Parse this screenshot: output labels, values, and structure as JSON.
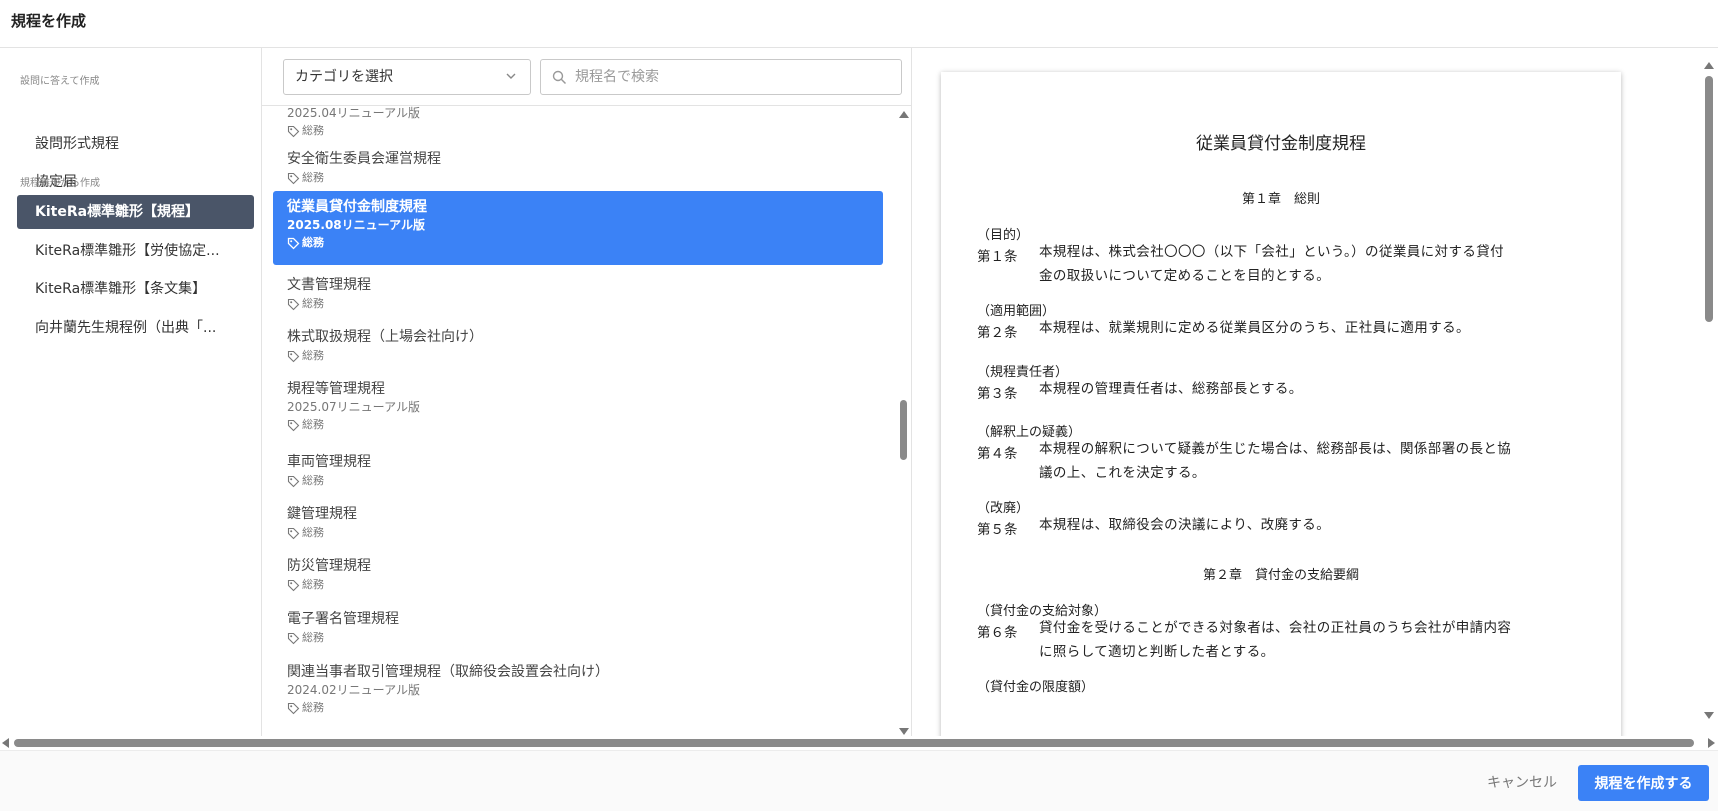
{
  "header": {
    "title": "規程を作成"
  },
  "sidebar": {
    "sections": [
      "設問に答えて作成",
      "規程雛形から作成"
    ],
    "items": [
      {
        "label": "設問形式規程"
      },
      {
        "label": "協定届"
      },
      {
        "label": "KiteRa標準雛形【規程】"
      },
      {
        "label": "KiteRa標準雛形【労使協定..."
      },
      {
        "label": "KiteRa標準雛形【条文集】"
      },
      {
        "label": "向井蘭先生規程例（出典「..."
      }
    ]
  },
  "filters": {
    "category_label": "カテゴリを選択",
    "search_placeholder": "規程名で検索"
  },
  "list": {
    "items": [
      {
        "title": "",
        "sub": "2025.04リニューアル版",
        "tag": "総務"
      },
      {
        "title": "安全衛生委員会運営規程",
        "sub": "",
        "tag": "総務"
      },
      {
        "title": "従業員貸付金制度規程",
        "sub": "2025.08リニューアル版",
        "tag": "総務"
      },
      {
        "title": "文書管理規程",
        "sub": "",
        "tag": "総務"
      },
      {
        "title": "株式取扱規程（上場会社向け）",
        "sub": "",
        "tag": "総務"
      },
      {
        "title": "規程等管理規程",
        "sub": "2025.07リニューアル版",
        "tag": "総務"
      },
      {
        "title": "車両管理規程",
        "sub": "",
        "tag": "総務"
      },
      {
        "title": "鍵管理規程",
        "sub": "",
        "tag": "総務"
      },
      {
        "title": "防災管理規程",
        "sub": "",
        "tag": "総務"
      },
      {
        "title": "電子署名管理規程",
        "sub": "",
        "tag": "総務"
      },
      {
        "title": "関連当事者取引管理規程（取締役会設置会社向け）",
        "sub": "2024.02リニューアル版",
        "tag": "総務"
      }
    ]
  },
  "preview": {
    "title": "従業員貸付金制度規程",
    "chapter1": "第１章　総則",
    "chapter2": "第２章　貸付金の支給要綱",
    "articles": [
      {
        "heading": "（目的）",
        "label": "第１条",
        "line1": "本規程は、株式会社〇〇〇（以下「会社」という。）の従業員に対する貸付",
        "line2": "金の取扱いについて定めることを目的とする。"
      },
      {
        "heading": "（適用範囲）",
        "label": "第２条",
        "line1": "本規程は、就業規則に定める従業員区分のうち、正社員に適用する。",
        "line2": ""
      },
      {
        "heading": "（規程責任者）",
        "label": "第３条",
        "line1": "本規程の管理責任者は、総務部長とする。",
        "line2": ""
      },
      {
        "heading": "（解釈上の疑義）",
        "label": "第４条",
        "line1": "本規程の解釈について疑義が生じた場合は、総務部長は、関係部署の長と協",
        "line2": "議の上、これを決定する。"
      },
      {
        "heading": "（改廃）",
        "label": "第５条",
        "line1": "本規程は、取締役会の決議により、改廃する。",
        "line2": ""
      },
      {
        "heading": "（貸付金の支給対象）",
        "label": "第６条",
        "line1": "貸付金を受けることができる対象者は、会社の正社員のうち会社が申請内容",
        "line2": "に照らして適切と判断した者とする。"
      }
    ],
    "next_heading": "（貸付金の限度額）"
  },
  "footer": {
    "cancel_label": "キャンセル",
    "create_label": "規程を作成する"
  },
  "colors": {
    "accent": "#3b82f6",
    "sidebar_active": "#4a5568"
  }
}
